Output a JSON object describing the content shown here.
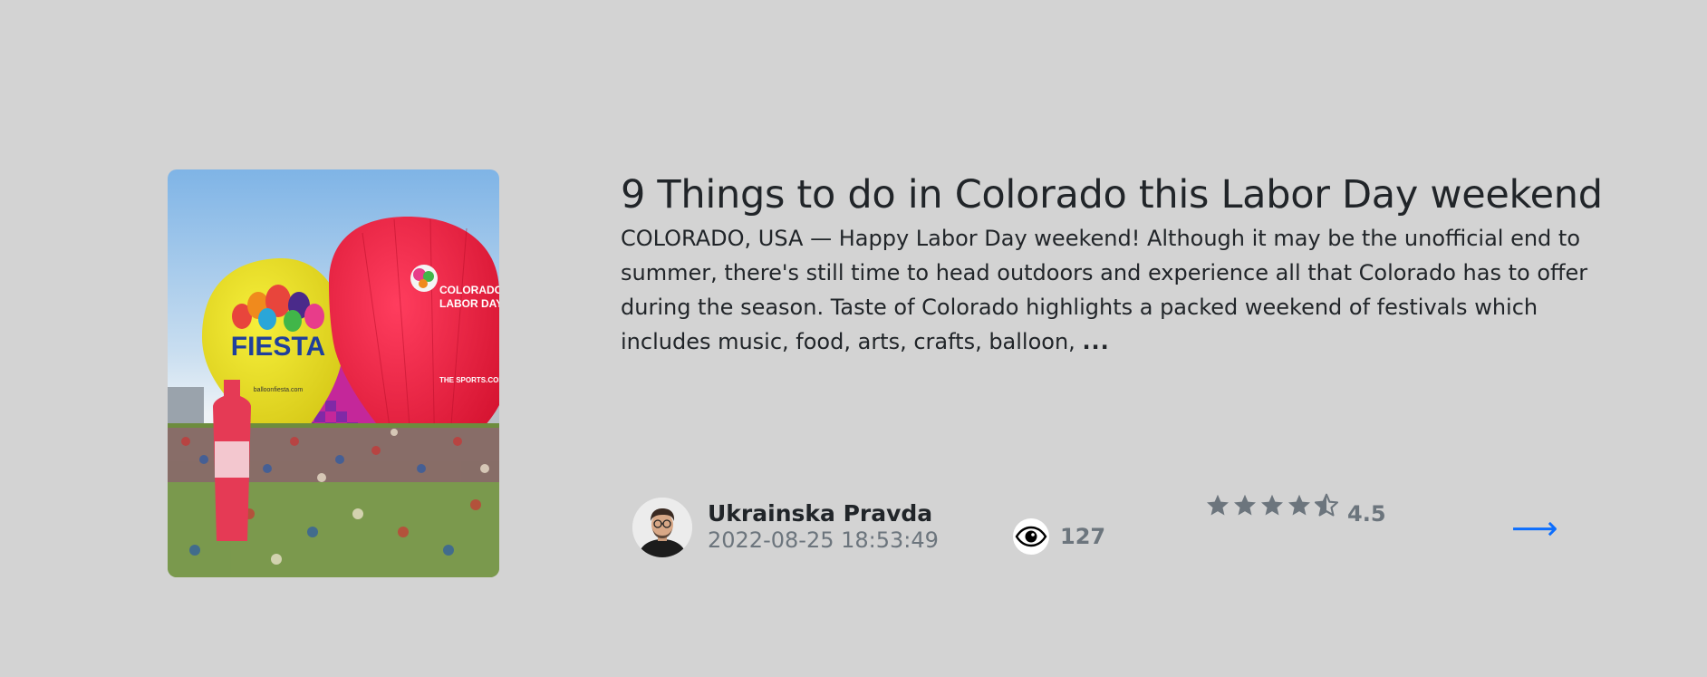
{
  "article": {
    "title": "9 Things to do in Colorado this Labor Day weekend",
    "excerpt": "COLORADO, USA — Happy Labor Day weekend! Although it may be the unofficial end to summer, there's still time to head outdoors and experience all that Colorado has to offer during the season. Taste of Colorado highlights a packed weekend of festivals which includes music, food, arts, crafts, balloon, ",
    "more": "...",
    "image": {
      "balloon_left_text": "FIESTA",
      "balloon_left_subtext": "balloonfiesta.com",
      "balloon_right_text_1": "COLORADO S",
      "balloon_right_text_2": "LABOR DAY",
      "balloon_right_text_3": "THE SPORTS.COM"
    }
  },
  "author": {
    "name": "Ukrainska Pravda",
    "date": "2022-08-25 18:53:49"
  },
  "stats": {
    "views": "127",
    "rating": "4.5",
    "rating_fraction": 0.9
  },
  "link": {
    "arrow": "⟶"
  },
  "colors": {
    "background": "#d3d3d3",
    "link": "#0d6efd",
    "muted": "#6c757d",
    "star": "#6c757d"
  },
  "icons": {
    "views": "eye-icon",
    "rating": "star-icon",
    "link": "arrow-right-icon"
  }
}
